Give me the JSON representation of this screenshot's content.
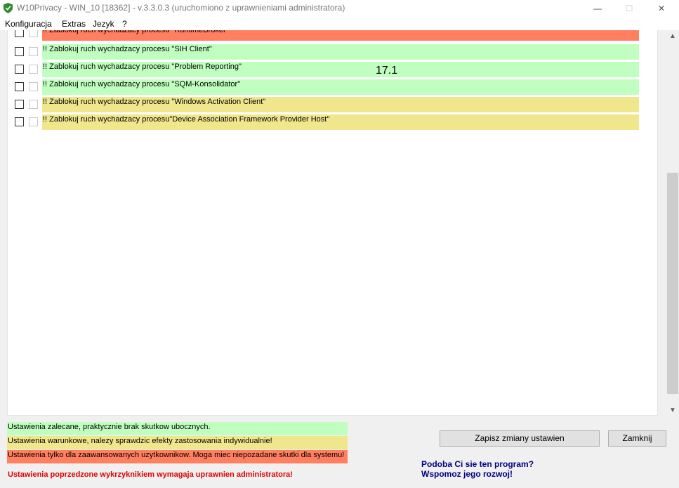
{
  "window": {
    "title": "W10Privacy - WIN_10 [18362]  - v.3.3.0.3 (uruchomiono z uprawnieniami administratora)",
    "minimize": "—",
    "maximize": "☐",
    "close": "✕"
  },
  "menu": [
    "Konfiguracja",
    "Extras",
    "Jezyk",
    "?"
  ],
  "section_number": "17.1",
  "rows": [
    {
      "label": "!! Zablokuj ruch wychadzacy procesu \"RuntimeBroker\"",
      "color": "red"
    },
    {
      "label": "!! Zablokuj ruch wychadzacy procesu \"SIH Client\"",
      "color": "green"
    },
    {
      "label": "!! Zablokuj ruch wychadzacy procesu \"Problem Reporting\"",
      "color": "green"
    },
    {
      "label": "!! Zablokuj ruch wychadzacy procesu \"SQM-Konsolidator\"",
      "color": "green"
    },
    {
      "label": "!! Zablokuj ruch wychadzacy procesu \"Windows Activation Client\"",
      "color": "yellow"
    },
    {
      "label": "!! Zablokuj ruch wychadzacy procesu\"Device Association Framework Provider Host\"",
      "color": "yellow"
    }
  ],
  "legend": {
    "green": "Ustawienia zalecane, praktycznie brak skutkow ubocznych.",
    "yellow": "Ustawienia warunkowe, nalezy sprawdzic efekty zastosowania indywidualnie!",
    "red": "Ustawienia tylko dla zaawansowanych uzytkownikow. Moga miec niepozadane skutki dla systemu!"
  },
  "admin_note": "Ustawienia poprzedzone wykrzyknikiem wymagaja uprawnien administratora!",
  "buttons": {
    "save": "Zapisz zmiany ustawien",
    "close": "Zamknij"
  },
  "promo": {
    "line1": "Podoba Ci sie ten program?",
    "line2": "Wspomoz jego rozwoj!"
  },
  "colors": {
    "green": "#c0ffc0",
    "yellow": "#f0e68c",
    "red": "#ff7f60",
    "admin_note": "#e00000",
    "promo": "#000080"
  }
}
